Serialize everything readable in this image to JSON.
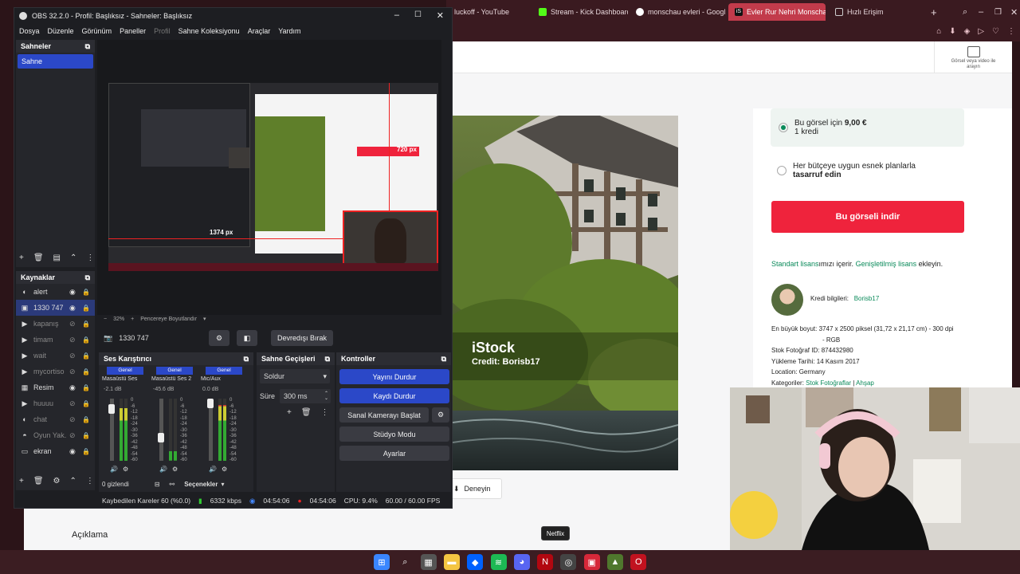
{
  "browser": {
    "tabs": [
      {
        "label": "luckoff - YouTube",
        "color": "#ff3d3d"
      },
      {
        "label": "Stream - Kick Dashboard",
        "color": "#53fc18"
      },
      {
        "label": "monschau evleri - Google",
        "color": "#ffffff"
      },
      {
        "label": "Evler Rur Nehri Monschau",
        "color": "#ffffff",
        "active": true
      },
      {
        "label": "Hızlı Erişim",
        "color": "#cccccc"
      }
    ],
    "new_tab": "+"
  },
  "istock": {
    "search_by_image": "Görsel veya video ile arayın",
    "option1_prefix": "Bu görsel için ",
    "option1_price": "9,00 €",
    "option1_credit": "1 kredi",
    "option2_line1": "Her bütçeye uygun esnek planlarla",
    "option2_line2": "tasarruf edin",
    "download_button": "Bu görseli indir",
    "license_link1": "Standart lisans",
    "license_text1": "ımızı içerir. ",
    "license_link2": "Genişletilmiş lisans",
    "license_text2": " ekleyin.",
    "credit_label": "Kredi bilgileri:",
    "credit_name": "Borisb17",
    "largest_size": "En büyük boyut: 3747 x 2500 piksel (31,72 x 21,17 cm) - 300 dpi",
    "largest_size2": "- RGB",
    "stock_id": "Stok Fotoğraf ID: 874432980",
    "upload_date": "Yükleme Tarihi: 14 Kasım 2017",
    "location": "Location: Germany",
    "categories_label": "Kategoriler: ",
    "category1": "Stok Fotoğraflar",
    "category2": "Ahşap",
    "watermark": "iStock",
    "watermark_credit": "Credit: Borisb17",
    "try_button": "Deneyin",
    "description_heading": "Açıklama"
  },
  "obs": {
    "title": "OBS 32.2.0 - Profil: Başlıksız - Sahneler: Başlıksız",
    "menu": [
      "Dosya",
      "Düzenle",
      "Görünüm",
      "Paneller",
      "Profil",
      "Sahne Koleksiyonu",
      "Araçlar",
      "Yardım"
    ],
    "scenes_header": "Sahneler",
    "scenes": [
      "Sahne"
    ],
    "sources_header": "Kaynaklar",
    "sources": [
      {
        "name": "alert",
        "icon": "globe-icon",
        "visible": true
      },
      {
        "name": "1330 747",
        "icon": "camera-icon",
        "visible": true,
        "selected": true
      },
      {
        "name": "kapanış",
        "icon": "play-icon",
        "visible": false
      },
      {
        "name": "timam",
        "icon": "play-icon",
        "visible": false
      },
      {
        "name": "wait",
        "icon": "play-icon",
        "visible": false
      },
      {
        "name": "mycortiso",
        "icon": "play-icon",
        "visible": false
      },
      {
        "name": "Resim",
        "icon": "image-icon",
        "visible": true
      },
      {
        "name": "huuuu",
        "icon": "play-icon",
        "visible": false
      },
      {
        "name": "chat",
        "icon": "globe-icon",
        "visible": false
      },
      {
        "name": "Oyun Yak.",
        "icon": "gamepad-icon",
        "visible": false
      },
      {
        "name": "ekran",
        "icon": "monitor-icon",
        "visible": true
      }
    ],
    "preview_px_label": "1374 px",
    "preview_px_label2": "720 px",
    "zoom_text": "32%",
    "fit_text": "Pencereye Boyutlandır",
    "source_bar_name": "1330 747",
    "deactivate_button": "Devredışı Bırak",
    "mixer_header": "Ses Karıştırıcı",
    "mixer_channels": [
      {
        "tag": "Genel",
        "name": "Masaüstü Ses",
        "db": "-2.1 dB",
        "level": 0.85,
        "fader": 0.9
      },
      {
        "tag": "Genel",
        "name": "Masaüstü Ses 2",
        "db": "-45.6 dB",
        "level": 0.15,
        "fader": 0.35
      },
      {
        "tag": "Genel",
        "name": "Mic/Aux",
        "db": "0.0 dB",
        "level": 0.9,
        "fader": 1.0
      }
    ],
    "meter_ticks": [
      "0",
      "-6",
      "-12",
      "-18",
      "-24",
      "-30",
      "-36",
      "-42",
      "-48",
      "-54",
      "-60"
    ],
    "hidden_count": "0 gizlendi",
    "options_button": "Seçenekler",
    "transitions_header": "Sahne Geçişleri",
    "transition_value": "Soldur",
    "duration_label": "Süre",
    "duration_value": "300 ms",
    "controls_header": "Kontroller",
    "controls": {
      "stop_stream": "Yayını Durdur",
      "stop_record": "Kaydı Durdur",
      "virtual_cam": "Sanal Kamerayı Başlat",
      "studio_mode": "Stüdyo Modu",
      "settings": "Ayarlar"
    },
    "status": {
      "dropped": "Kaybedilen Kareler 60 (%0.0)",
      "bitrate": "6332 kbps",
      "stream_time": "04:54:06",
      "record_time": "04:54:06",
      "cpu": "CPU: 9.4%",
      "fps": "60.00 / 60.00 FPS"
    }
  },
  "tooltip": "Netflix",
  "taskbar": [
    "windows-icon",
    "search-icon",
    "calculator-icon",
    "folder-icon",
    "dropbox-icon",
    "spotify-icon",
    "discord-icon",
    "netflix-icon",
    "obs-icon",
    "app-red-icon",
    "app-green-icon",
    "opera-icon"
  ]
}
